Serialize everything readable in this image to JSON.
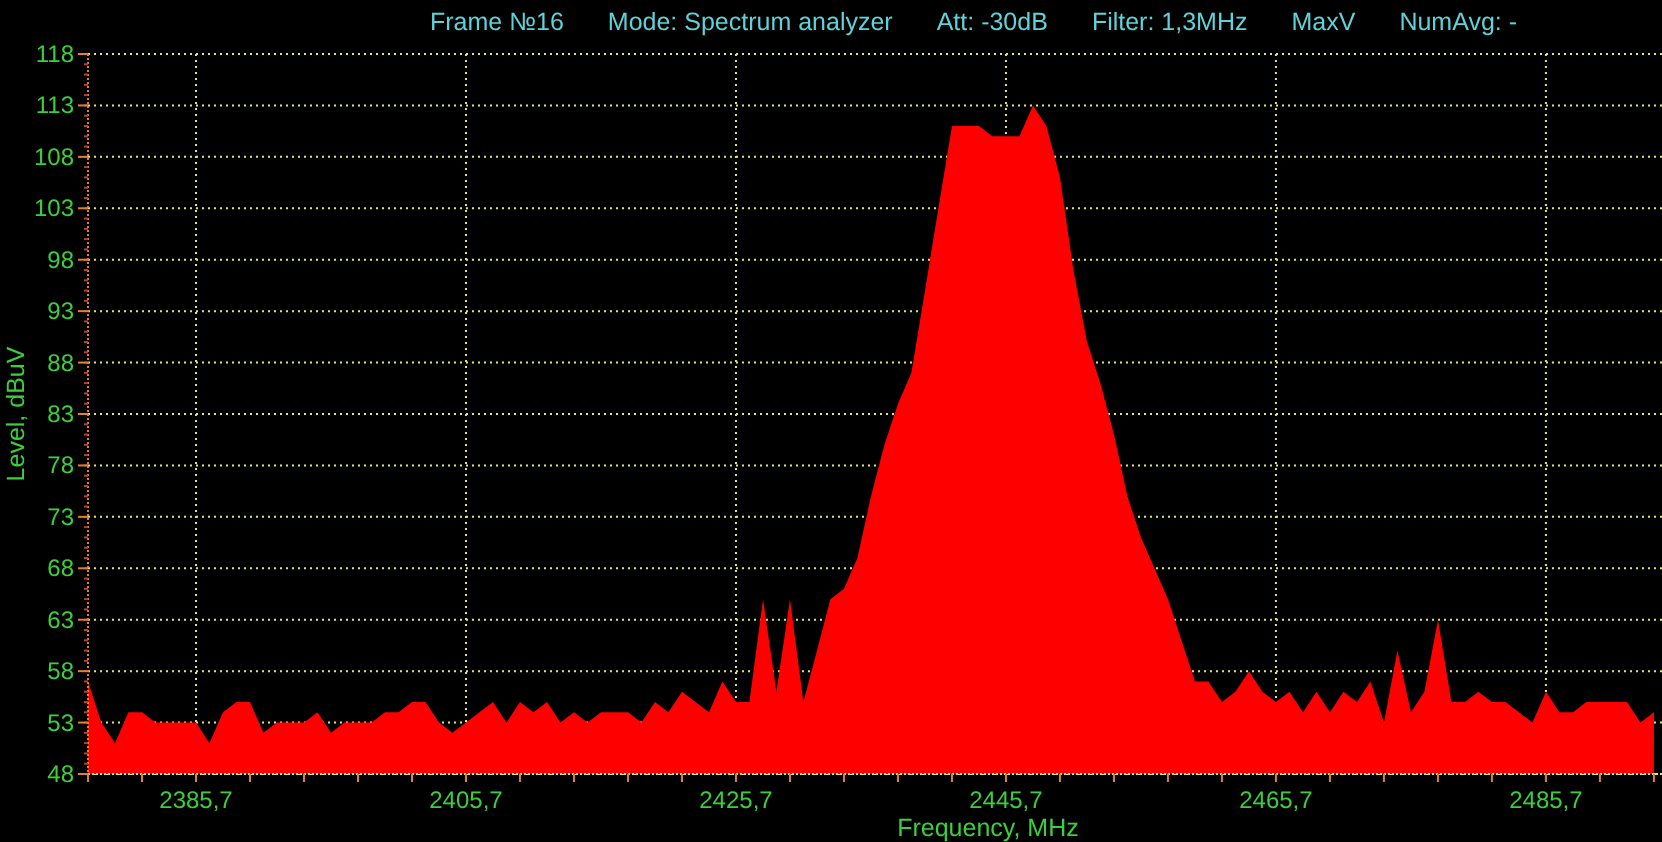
{
  "status_bar": [
    "Frame №16",
    "Mode: Spectrum analyzer",
    "Att: -30dB",
    "Filter: 1,3MHz",
    "MaxV",
    "NumAvg: -"
  ],
  "chart_data": {
    "type": "area",
    "grid": true,
    "xlabel": "Frequency, MHz",
    "ylabel": "Level, dBuV",
    "xlim": [
      2377.7,
      2494.3
    ],
    "ylim": [
      48,
      118
    ],
    "xticks": [
      {
        "value": 2385.7,
        "label": "2385,7"
      },
      {
        "value": 2405.7,
        "label": "2405,7"
      },
      {
        "value": 2425.7,
        "label": "2425,7"
      },
      {
        "value": 2445.7,
        "label": "2445,7"
      },
      {
        "value": 2465.7,
        "label": "2465,7"
      },
      {
        "value": 2485.7,
        "label": "2485,7"
      }
    ],
    "yticks": [
      48,
      53,
      58,
      63,
      68,
      73,
      78,
      83,
      88,
      93,
      98,
      103,
      108,
      113,
      118
    ],
    "x": [
      2377.7,
      2378.7,
      2379.7,
      2380.7,
      2381.7,
      2382.7,
      2383.7,
      2384.7,
      2385.7,
      2386.7,
      2387.7,
      2388.7,
      2389.7,
      2390.7,
      2391.7,
      2392.7,
      2393.7,
      2394.7,
      2395.7,
      2396.7,
      2397.7,
      2398.7,
      2399.7,
      2400.7,
      2401.7,
      2402.7,
      2403.7,
      2404.7,
      2405.7,
      2406.7,
      2407.7,
      2408.7,
      2409.7,
      2410.7,
      2411.7,
      2412.7,
      2413.7,
      2414.7,
      2415.7,
      2416.7,
      2417.7,
      2418.7,
      2419.7,
      2420.7,
      2421.7,
      2422.7,
      2423.7,
      2424.7,
      2425.7,
      2426.7,
      2427.7,
      2428.7,
      2429.7,
      2430.7,
      2431.7,
      2432.7,
      2433.7,
      2434.7,
      2435.7,
      2436.7,
      2437.7,
      2438.7,
      2439.7,
      2440.7,
      2441.7,
      2442.7,
      2443.7,
      2444.7,
      2445.7,
      2446.7,
      2447.7,
      2448.7,
      2449.7,
      2450.7,
      2451.7,
      2452.7,
      2453.7,
      2454.7,
      2455.7,
      2456.7,
      2457.7,
      2458.7,
      2459.7,
      2460.7,
      2461.7,
      2462.7,
      2463.7,
      2464.7,
      2465.7,
      2466.7,
      2467.7,
      2468.7,
      2469.7,
      2470.7,
      2471.7,
      2472.7,
      2473.7,
      2474.7,
      2475.7,
      2476.7,
      2477.7,
      2478.7,
      2479.7,
      2480.7,
      2481.7,
      2482.7,
      2483.7,
      2484.7,
      2485.7,
      2486.7,
      2487.7,
      2488.7,
      2489.7,
      2490.7,
      2491.7,
      2492.7,
      2493.7
    ],
    "series": [
      {
        "color": "#ff0000",
        "values": [
          57,
          53,
          51,
          54,
          54,
          53,
          53,
          53,
          53,
          51,
          54,
          55,
          55,
          52,
          53,
          53,
          53,
          54,
          52,
          53,
          53,
          53,
          54,
          54,
          55,
          55,
          53,
          52,
          53,
          54,
          55,
          53,
          55,
          54,
          55,
          53,
          54,
          53,
          54,
          54,
          54,
          53,
          55,
          54,
          56,
          55,
          54,
          57,
          55,
          55,
          65,
          56,
          65,
          55,
          60,
          65,
          66,
          69,
          75,
          80,
          84,
          87,
          95,
          103,
          111,
          111,
          111,
          110,
          110,
          110,
          113,
          111,
          106,
          97,
          90,
          86,
          81,
          75,
          71,
          68,
          65,
          61,
          57,
          57,
          55,
          56,
          58,
          56,
          55,
          56,
          54,
          56,
          54,
          56,
          55,
          57,
          53,
          60,
          54,
          56,
          63,
          55,
          55,
          56,
          55,
          55,
          54,
          53,
          56,
          54,
          54,
          55,
          55,
          55,
          55,
          53,
          54
        ]
      }
    ]
  }
}
